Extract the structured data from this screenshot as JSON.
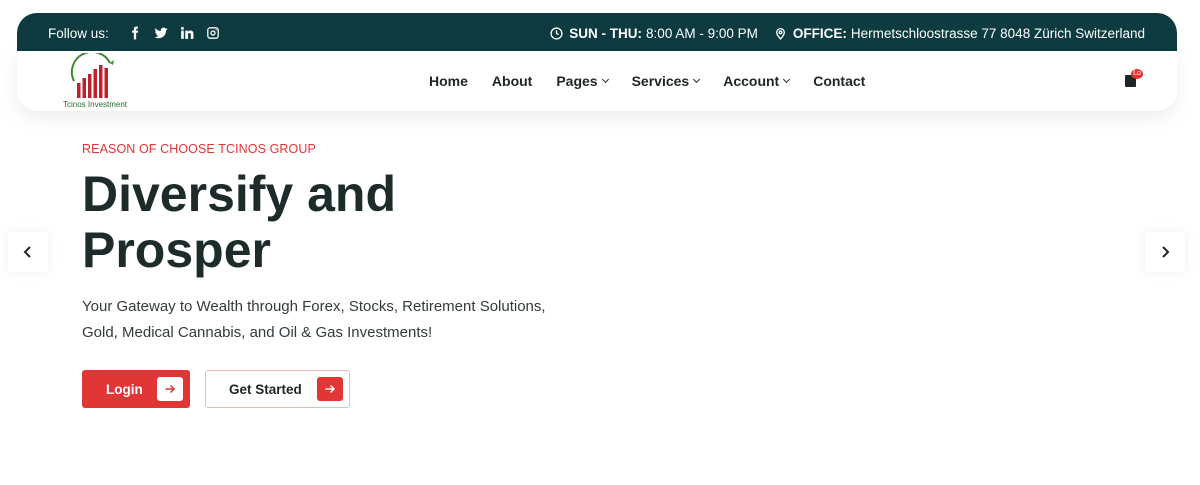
{
  "topbar": {
    "follow_label": "Follow us:",
    "social_icons": [
      "facebook-icon",
      "twitter-icon",
      "linkedin-icon",
      "instagram-icon"
    ],
    "hours_label": "SUN - THU:",
    "hours_value": "8:00 AM - 9:00 PM",
    "office_label": "OFFICE:",
    "office_value": "Hermetschloostrasse 77 8048 Zürich Switzerland"
  },
  "brand": {
    "name": "Tcinos Investment"
  },
  "nav": {
    "items": [
      {
        "label": "Home",
        "dropdown": false
      },
      {
        "label": "About",
        "dropdown": false
      },
      {
        "label": "Pages",
        "dropdown": true
      },
      {
        "label": "Services",
        "dropdown": true
      },
      {
        "label": "Account",
        "dropdown": true
      },
      {
        "label": "Contact",
        "dropdown": false
      }
    ],
    "cart_badge": "Lo"
  },
  "hero": {
    "kicker": "REASON OF CHOOSE TCINOS GROUP",
    "title": "Diversify and Prosper",
    "subtitle": "Your Gateway to Wealth through Forex, Stocks, Retirement Solutions, Gold, Medical Cannabis, and Oil & Gas Investments!",
    "login_label": "Login",
    "start_label": "Get Started"
  },
  "colors": {
    "topbar_bg": "#0e3b40",
    "accent": "#e23535",
    "heading": "#1d2b2b"
  }
}
